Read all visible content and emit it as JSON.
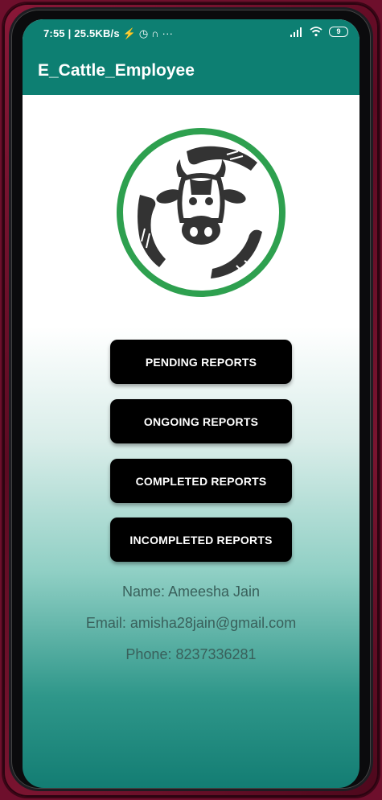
{
  "status_bar": {
    "time_speed": "7:55 | 25.5KB/s",
    "extra_icons": "⚡ ◷ ∩ ···",
    "battery": "9"
  },
  "app_bar": {
    "title": "E_Cattle_Employee"
  },
  "logo": {
    "icon": "cattle-care-logo",
    "ring_color": "#2ea04f",
    "art_color": "#333333"
  },
  "buttons": [
    {
      "label": "PENDING REPORTS"
    },
    {
      "label": "ONGOING REPORTS"
    },
    {
      "label": "COMPLETED REPORTS"
    },
    {
      "label": "INCOMPLETED REPORTS"
    }
  ],
  "profile": {
    "name": "Name: Ameesha Jain",
    "email": "Email: amisha28jain@gmail.com",
    "phone": "Phone: 8237336281"
  },
  "colors": {
    "primary": "#0d7f72",
    "button": "#000000",
    "text_muted": "#39605b"
  }
}
